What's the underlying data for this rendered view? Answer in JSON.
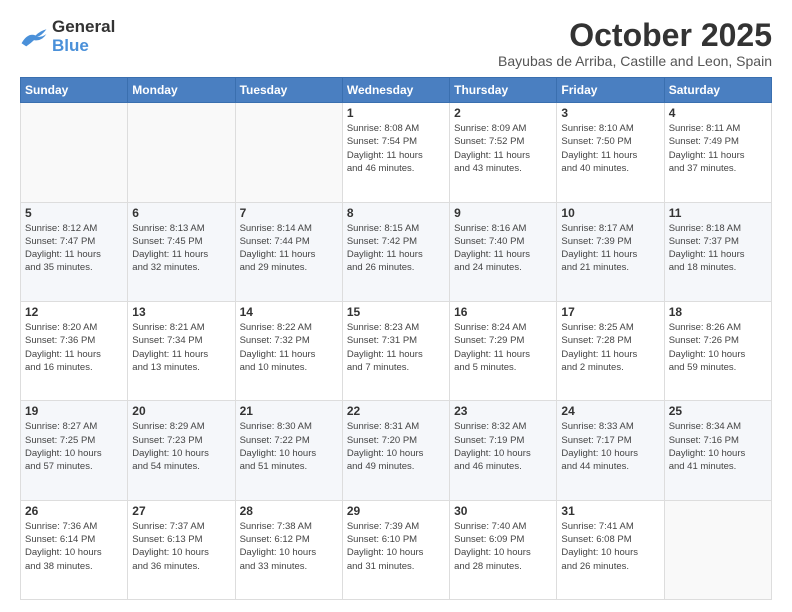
{
  "header": {
    "logo_general": "General",
    "logo_blue": "Blue",
    "month_title": "October 2025",
    "subtitle": "Bayubas de Arriba, Castille and Leon, Spain"
  },
  "columns": [
    "Sunday",
    "Monday",
    "Tuesday",
    "Wednesday",
    "Thursday",
    "Friday",
    "Saturday"
  ],
  "weeks": [
    [
      {
        "day": "",
        "info": ""
      },
      {
        "day": "",
        "info": ""
      },
      {
        "day": "",
        "info": ""
      },
      {
        "day": "1",
        "info": "Sunrise: 8:08 AM\nSunset: 7:54 PM\nDaylight: 11 hours\nand 46 minutes."
      },
      {
        "day": "2",
        "info": "Sunrise: 8:09 AM\nSunset: 7:52 PM\nDaylight: 11 hours\nand 43 minutes."
      },
      {
        "day": "3",
        "info": "Sunrise: 8:10 AM\nSunset: 7:50 PM\nDaylight: 11 hours\nand 40 minutes."
      },
      {
        "day": "4",
        "info": "Sunrise: 8:11 AM\nSunset: 7:49 PM\nDaylight: 11 hours\nand 37 minutes."
      }
    ],
    [
      {
        "day": "5",
        "info": "Sunrise: 8:12 AM\nSunset: 7:47 PM\nDaylight: 11 hours\nand 35 minutes."
      },
      {
        "day": "6",
        "info": "Sunrise: 8:13 AM\nSunset: 7:45 PM\nDaylight: 11 hours\nand 32 minutes."
      },
      {
        "day": "7",
        "info": "Sunrise: 8:14 AM\nSunset: 7:44 PM\nDaylight: 11 hours\nand 29 minutes."
      },
      {
        "day": "8",
        "info": "Sunrise: 8:15 AM\nSunset: 7:42 PM\nDaylight: 11 hours\nand 26 minutes."
      },
      {
        "day": "9",
        "info": "Sunrise: 8:16 AM\nSunset: 7:40 PM\nDaylight: 11 hours\nand 24 minutes."
      },
      {
        "day": "10",
        "info": "Sunrise: 8:17 AM\nSunset: 7:39 PM\nDaylight: 11 hours\nand 21 minutes."
      },
      {
        "day": "11",
        "info": "Sunrise: 8:18 AM\nSunset: 7:37 PM\nDaylight: 11 hours\nand 18 minutes."
      }
    ],
    [
      {
        "day": "12",
        "info": "Sunrise: 8:20 AM\nSunset: 7:36 PM\nDaylight: 11 hours\nand 16 minutes."
      },
      {
        "day": "13",
        "info": "Sunrise: 8:21 AM\nSunset: 7:34 PM\nDaylight: 11 hours\nand 13 minutes."
      },
      {
        "day": "14",
        "info": "Sunrise: 8:22 AM\nSunset: 7:32 PM\nDaylight: 11 hours\nand 10 minutes."
      },
      {
        "day": "15",
        "info": "Sunrise: 8:23 AM\nSunset: 7:31 PM\nDaylight: 11 hours\nand 7 minutes."
      },
      {
        "day": "16",
        "info": "Sunrise: 8:24 AM\nSunset: 7:29 PM\nDaylight: 11 hours\nand 5 minutes."
      },
      {
        "day": "17",
        "info": "Sunrise: 8:25 AM\nSunset: 7:28 PM\nDaylight: 11 hours\nand 2 minutes."
      },
      {
        "day": "18",
        "info": "Sunrise: 8:26 AM\nSunset: 7:26 PM\nDaylight: 10 hours\nand 59 minutes."
      }
    ],
    [
      {
        "day": "19",
        "info": "Sunrise: 8:27 AM\nSunset: 7:25 PM\nDaylight: 10 hours\nand 57 minutes."
      },
      {
        "day": "20",
        "info": "Sunrise: 8:29 AM\nSunset: 7:23 PM\nDaylight: 10 hours\nand 54 minutes."
      },
      {
        "day": "21",
        "info": "Sunrise: 8:30 AM\nSunset: 7:22 PM\nDaylight: 10 hours\nand 51 minutes."
      },
      {
        "day": "22",
        "info": "Sunrise: 8:31 AM\nSunset: 7:20 PM\nDaylight: 10 hours\nand 49 minutes."
      },
      {
        "day": "23",
        "info": "Sunrise: 8:32 AM\nSunset: 7:19 PM\nDaylight: 10 hours\nand 46 minutes."
      },
      {
        "day": "24",
        "info": "Sunrise: 8:33 AM\nSunset: 7:17 PM\nDaylight: 10 hours\nand 44 minutes."
      },
      {
        "day": "25",
        "info": "Sunrise: 8:34 AM\nSunset: 7:16 PM\nDaylight: 10 hours\nand 41 minutes."
      }
    ],
    [
      {
        "day": "26",
        "info": "Sunrise: 7:36 AM\nSunset: 6:14 PM\nDaylight: 10 hours\nand 38 minutes."
      },
      {
        "day": "27",
        "info": "Sunrise: 7:37 AM\nSunset: 6:13 PM\nDaylight: 10 hours\nand 36 minutes."
      },
      {
        "day": "28",
        "info": "Sunrise: 7:38 AM\nSunset: 6:12 PM\nDaylight: 10 hours\nand 33 minutes."
      },
      {
        "day": "29",
        "info": "Sunrise: 7:39 AM\nSunset: 6:10 PM\nDaylight: 10 hours\nand 31 minutes."
      },
      {
        "day": "30",
        "info": "Sunrise: 7:40 AM\nSunset: 6:09 PM\nDaylight: 10 hours\nand 28 minutes."
      },
      {
        "day": "31",
        "info": "Sunrise: 7:41 AM\nSunset: 6:08 PM\nDaylight: 10 hours\nand 26 minutes."
      },
      {
        "day": "",
        "info": ""
      }
    ]
  ]
}
